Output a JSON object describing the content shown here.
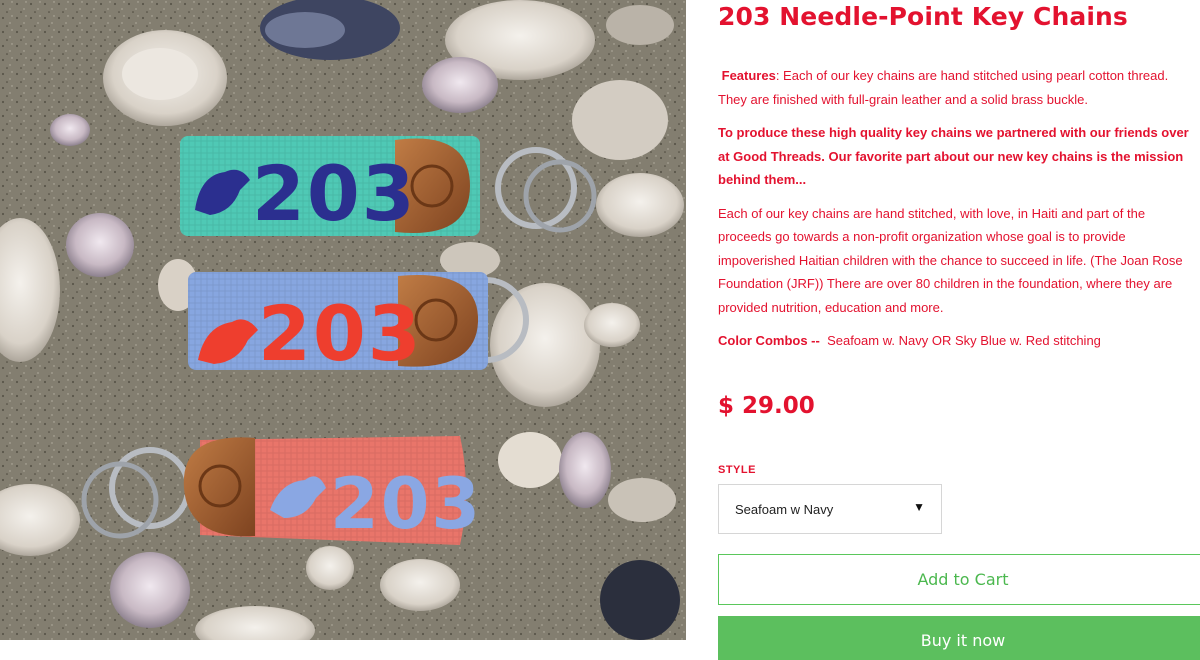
{
  "product": {
    "title": "203 Needle-Point Key Chains",
    "price": "$ 29.00"
  },
  "description": {
    "features_label": "Features",
    "features_text": ": Each of our key chains are hand stitched using pearl cotton thread. They are finished with full-grain leather and a solid brass buckle.",
    "partner_text": "To produce these high quality key chains we partnered with our friends over at Good Threads. Our favorite part about our new key chains is the mission behind them...",
    "mission_text": "Each of our key chains are hand stitched, with love, in Haiti and part of the proceeds go towards a non-profit organization whose goal is to provide impoverished Haitian children with the chance to succeed in life. (The Joan Rose Foundation (JRF)) There are over 80 children in the foundation, where they are provided nutrition, education and more.",
    "combos_label": "Color Combos --",
    "combos_text": "Seafoam w. Navy OR Sky Blue w. Red stitching"
  },
  "style": {
    "label": "STYLE",
    "selected": "Seafoam w Navy",
    "arrow": "▼"
  },
  "buttons": {
    "add_to_cart": "Add to Cart",
    "buy_now": "Buy it now"
  },
  "photo": {
    "keychains": [
      {
        "number": "203",
        "fabric_color": "#4fc9b5",
        "stitch_color": "#2b2f8f"
      },
      {
        "number": "203",
        "fabric_color": "#87a6e0",
        "stitch_color": "#ee3e2e"
      },
      {
        "number": "203",
        "fabric_color": "#e9756a",
        "stitch_color": "#8aa7e3"
      }
    ]
  },
  "colors": {
    "accent": "#e3122f",
    "button_green": "#5cbf5e",
    "leather": "#9c5a2c"
  }
}
